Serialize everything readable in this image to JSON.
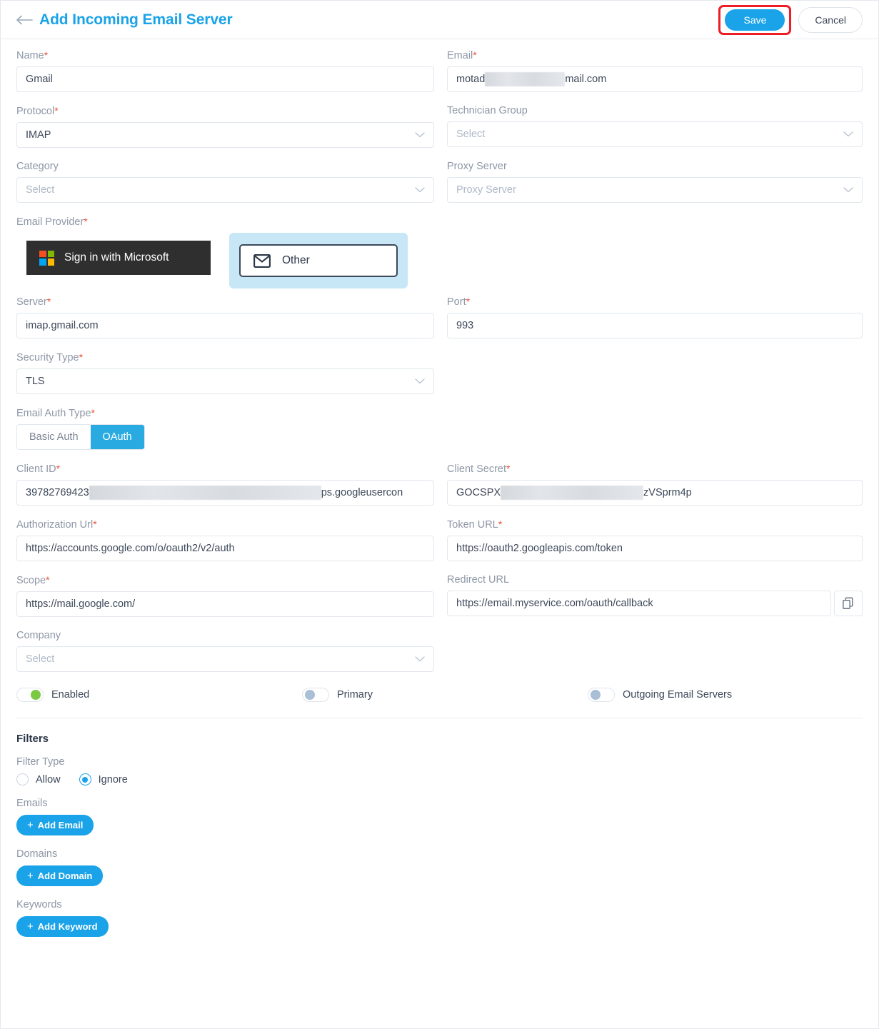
{
  "header": {
    "title": "Add Incoming Email Server",
    "back_icon": "arrow-left-icon",
    "save_label": "Save",
    "cancel_label": "Cancel",
    "accent_color": "#1aa3e8",
    "highlight_color": "#ee1c24"
  },
  "form": {
    "name": {
      "label": "Name",
      "required": true,
      "value": "Gmail"
    },
    "email": {
      "label": "Email",
      "required": true,
      "value_prefix": "motad",
      "value_suffix": "mail.com",
      "redacted": true
    },
    "protocol": {
      "label": "Protocol",
      "required": true,
      "value": "IMAP"
    },
    "technician_group": {
      "label": "Technician Group",
      "required": false,
      "placeholder": "Select",
      "value": ""
    },
    "category": {
      "label": "Category",
      "required": false,
      "placeholder": "Select",
      "value": ""
    },
    "proxy_server": {
      "label": "Proxy Server",
      "required": false,
      "placeholder": "Proxy Server",
      "value": ""
    },
    "email_provider": {
      "label": "Email Provider",
      "required": true,
      "microsoft_label": "Sign in with Microsoft",
      "other_label": "Other",
      "selected": "Other"
    },
    "server": {
      "label": "Server",
      "required": true,
      "value": "imap.gmail.com"
    },
    "port": {
      "label": "Port",
      "required": true,
      "value": "993"
    },
    "security_type": {
      "label": "Security Type",
      "required": true,
      "value": "TLS"
    },
    "email_auth_type": {
      "label": "Email Auth Type",
      "required": true,
      "options": [
        "Basic Auth",
        "OAuth"
      ],
      "selected": "OAuth"
    },
    "client_id": {
      "label": "Client ID",
      "required": true,
      "value_prefix": "39782769423",
      "value_suffix": "ps.googleusercon",
      "redacted": true
    },
    "client_secret": {
      "label": "Client Secret",
      "required": true,
      "value_prefix": "GOCSPX",
      "value_suffix": "zVSprm4p",
      "redacted": true
    },
    "authorization_url": {
      "label": "Authorization Url",
      "required": true,
      "value": "https://accounts.google.com/o/oauth2/v2/auth"
    },
    "token_url": {
      "label": "Token URL",
      "required": true,
      "value": "https://oauth2.googleapis.com/token"
    },
    "scope": {
      "label": "Scope",
      "required": true,
      "value": "https://mail.google.com/"
    },
    "redirect_url": {
      "label": "Redirect URL",
      "required": false,
      "value": "https://email.myservice.com/oauth/callback",
      "copy_icon": "copy-icon"
    },
    "company": {
      "label": "Company",
      "required": false,
      "placeholder": "Select",
      "value": ""
    }
  },
  "toggles": [
    {
      "label": "Enabled",
      "state": "on"
    },
    {
      "label": "Primary",
      "state": "off"
    },
    {
      "label": "Outgoing Email Servers",
      "state": "off"
    }
  ],
  "filters": {
    "title": "Filters",
    "filter_type_label": "Filter Type",
    "options": [
      {
        "label": "Allow",
        "checked": false
      },
      {
        "label": "Ignore",
        "checked": true
      }
    ],
    "emails_label": "Emails",
    "add_email_label": "Add Email",
    "domains_label": "Domains",
    "add_domain_label": "Add Domain",
    "keywords_label": "Keywords",
    "add_keyword_label": "Add Keyword",
    "plus_glyph": "+"
  }
}
